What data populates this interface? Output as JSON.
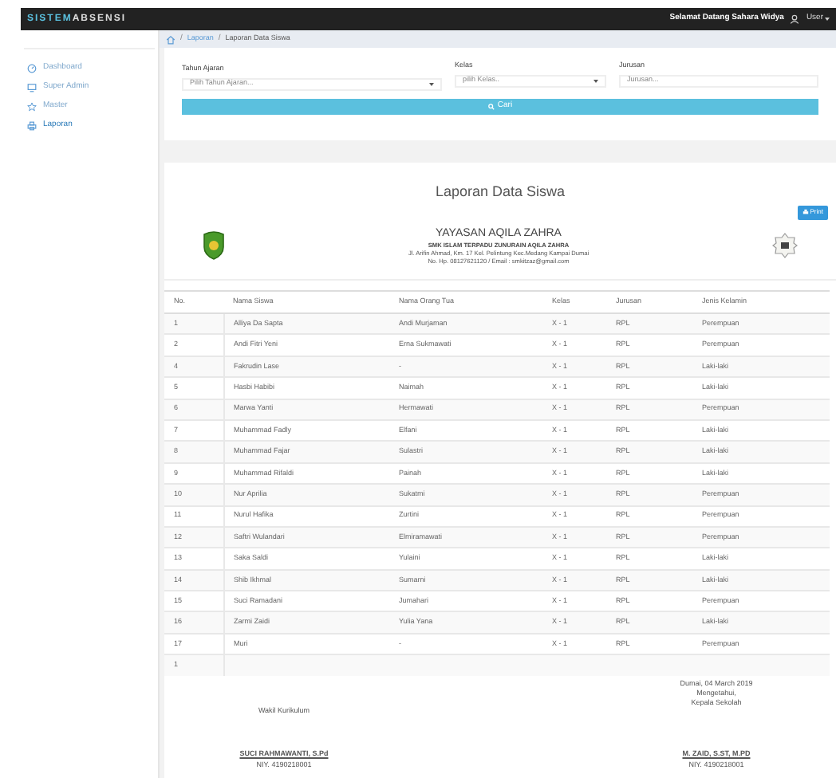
{
  "topbar": {
    "brand_part1": "SISTEM",
    "brand_part2": "ABSENSI",
    "greeting": "Selamat Datang Sahara Widya",
    "user": "User"
  },
  "sidebar": {
    "items": [
      {
        "label": "Dashboard",
        "selected": false
      },
      {
        "label": "Super Admin",
        "selected": false
      },
      {
        "label": "Master",
        "selected": false
      },
      {
        "label": "Laporan",
        "selected": true
      }
    ]
  },
  "breadcrumb": {
    "separator": "/",
    "items": [
      {
        "label": "Laporan",
        "link": true
      },
      {
        "label": "Laporan Data Siswa",
        "link": false
      }
    ]
  },
  "filters": [
    {
      "label": "Tahun Ajaran",
      "kind": "select",
      "placeholder": "Pilih Tahun Ajaran..."
    },
    {
      "label": "Kelas",
      "kind": "select",
      "placeholder": "pilih Kelas.."
    },
    {
      "label": "Jurusan",
      "kind": "input",
      "placeholder": "Jurusan..."
    }
  ],
  "search_button": "Cari",
  "report": {
    "title": "Laporan Data Siswa",
    "print_button": "Print",
    "org_name": "YAYASAN AQILA ZAHRA",
    "org_lines": [
      "SMK ISLAM TERPADU ZUNURAIN AQILA ZAHRA",
      "Jl. Arifin Ahmad, Km. 17 Kel. Pelintung Kec.Medang Kampai Dumai",
      "No. Hp. 08127621120 / Email : smkitzaz@gmail.com"
    ],
    "table": {
      "columns": [
        "No.",
        "Nama Siswa",
        "Nama Orang Tua",
        "Kelas",
        "Jurusan",
        "Jenis Kelamin"
      ],
      "rows": [
        [
          "1",
          "Alliya Da Sapta",
          "Andi Murjaman",
          "X - 1",
          "RPL",
          "Perempuan"
        ],
        [
          "2",
          "Andi Fitri Yeni",
          "Erna Sukmawati",
          "X - 1",
          "RPL",
          "Perempuan"
        ],
        [
          "4",
          "Fakrudin Lase",
          "-",
          "X - 1",
          "RPL",
          "Laki-laki"
        ],
        [
          "5",
          "Hasbi Habibi",
          "Naimah",
          "X - 1",
          "RPL",
          "Laki-laki"
        ],
        [
          "6",
          "Marwa Yanti",
          "Hermawati",
          "X - 1",
          "RPL",
          "Perempuan"
        ],
        [
          "7",
          "Muhammad Fadly",
          "Elfani",
          "X - 1",
          "RPL",
          "Laki-laki"
        ],
        [
          "8",
          "Muhammad Fajar",
          "Sulastri",
          "X - 1",
          "RPL",
          "Laki-laki"
        ],
        [
          "9",
          "Muhammad Rifaldi",
          "Painah",
          "X - 1",
          "RPL",
          "Laki-laki"
        ],
        [
          "10",
          "Nur Aprilia",
          "Sukatmi",
          "X - 1",
          "RPL",
          "Perempuan"
        ],
        [
          "11",
          "Nurul Hafika",
          "Zurtini",
          "X - 1",
          "RPL",
          "Perempuan"
        ],
        [
          "12",
          "Saftri Wulandari",
          "Elmiramawati",
          "X - 1",
          "RPL",
          "Perempuan"
        ],
        [
          "13",
          "Saka Saldi",
          "Yulaini",
          "X - 1",
          "RPL",
          "Laki-laki"
        ],
        [
          "14",
          "Shib Ikhmal",
          "Sumarni",
          "X - 1",
          "RPL",
          "Laki-laki"
        ],
        [
          "15",
          "Suci Ramadani",
          "Jumahari",
          "X - 1",
          "RPL",
          "Perempuan"
        ],
        [
          "16",
          "Zarmi Zaidi",
          "Yulia Yana",
          "X - 1",
          "RPL",
          "Laki-laki"
        ],
        [
          "17",
          "Muri",
          "-",
          "X - 1",
          "RPL",
          "Perempuan"
        ],
        [
          "1"
        ]
      ]
    },
    "signatures": [
      {
        "lines": [
          "Wakil Kurikulum"
        ],
        "name": "SUCI RAHMAWANTI, S.Pd",
        "id": "NIY. 4190218001"
      },
      {
        "lines": [
          "Dumai, 04 March 2019",
          "Mengetahui,",
          "Kepala Sekolah"
        ],
        "name": "M. ZAID, S.ST, M.PD",
        "id": "NIY. 4190218001"
      }
    ]
  }
}
